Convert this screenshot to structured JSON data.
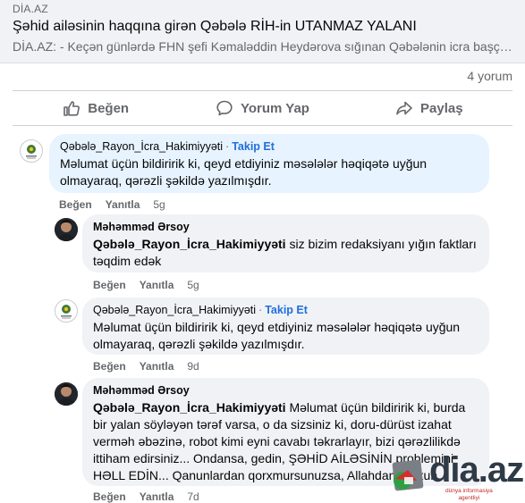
{
  "link_preview": {
    "source": "DİA.AZ",
    "title": "Şəhid ailəsinin haqqına girən Qəbələ RİH-in UTANMAZ YALANI",
    "description": "DİA.AZ: - Keçən günlərdə FHN şefi Kəmaləddin Heydərova sığınan Qəbələnin icra başçı..."
  },
  "comment_count": "4 yorum",
  "actions": {
    "like": "Beğen",
    "comment": "Yorum Yap",
    "share": "Paylaş"
  },
  "comments": [
    {
      "author": "Qəbələ_Rayon_İcra_Hakimiyyəti",
      "follow": "Takip Et",
      "tag": "",
      "text": "Məlumat üçün bildiririk ki, qeyd etdiyiniz məsələlər həqiqətə uyğun olmayaraq, qərəzli şəkildə yazılmışdır.",
      "like": "Beğen",
      "reply": "Yanıtla",
      "time": "5g"
    },
    {
      "author": "Məhəmməd Ərsoy",
      "follow": "",
      "tag": "Qəbələ_Rayon_İcra_Hakimiyyəti",
      "text": "siz bizim redaksiyanı yığın faktları təqdim edək",
      "like": "Beğen",
      "reply": "Yanıtla",
      "time": "5g"
    },
    {
      "author": "Qəbələ_Rayon_İcra_Hakimiyyəti",
      "follow": "Takip Et",
      "tag": "",
      "text": "Məlumat üçün bildiririk ki, qeyd etdiyiniz məsələlər həqiqətə uyğun olmayaraq, qərəzli şəkildə yazılmışdır.",
      "like": "Beğen",
      "reply": "Yanıtla",
      "time": "9d"
    },
    {
      "author": "Məhəmməd Ərsoy",
      "follow": "",
      "tag": "Qəbələ_Rayon_İcra_Hakimiyyəti",
      "text": "Məlumat üçün bildiririk ki, burda bir yalan söyləyən tərəf varsa, o da sizsiniz ki, doru-dürüst izahat verməh əbəzinə, robot kimi eyni cavabı təkrarlayır, bizi qərəzlilikdə ittiham edirsiniz... Ondansa, gedin, ŞƏHİD AİLƏSİNİN problemini HƏLL EDİN... Qanunlardan qorxmursunuzsa, Allahdan qorxun...",
      "like": "Beğen",
      "reply": "Yanıtla",
      "time": "7d"
    }
  ],
  "watermark": {
    "logo_text": "dia.az",
    "tagline_1": "dünya informasiya",
    "tagline_2": "agentliyi"
  },
  "colors": {
    "accent_blue": "#216fdb",
    "bubble_gray": "#f0f2f5",
    "bubble_highlight": "#e7f3ff",
    "muted_text": "#65676b"
  }
}
